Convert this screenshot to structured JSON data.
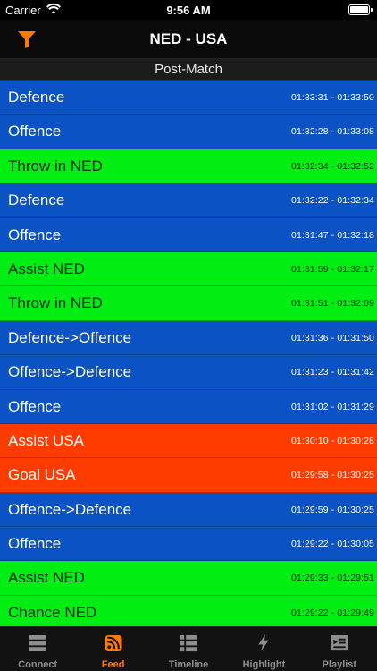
{
  "status": {
    "carrier": "Carrier",
    "time": "9:56 AM"
  },
  "nav": {
    "title": "NED - USA"
  },
  "section": {
    "header": "Post-Match"
  },
  "colors": {
    "accent": "#ff7a00",
    "blue": "#0b52c4",
    "green": "#00ee12",
    "orange": "#ff3c00"
  },
  "feed": [
    {
      "label": "Defence",
      "range": "01:33:31 - 01:33:50",
      "kind": "defence"
    },
    {
      "label": "Offence",
      "range": "01:32:28 - 01:33:08",
      "kind": "offence"
    },
    {
      "label": "Throw in NED",
      "range": "01:32:34 - 01:32:52",
      "kind": "green"
    },
    {
      "label": "Defence",
      "range": "01:32:22 - 01:32:34",
      "kind": "defence"
    },
    {
      "label": "Offence",
      "range": "01:31:47 - 01:32:18",
      "kind": "offence"
    },
    {
      "label": "Assist NED",
      "range": "01:31:59 - 01:32:17",
      "kind": "green"
    },
    {
      "label": "Throw in NED",
      "range": "01:31:51 - 01:32:09",
      "kind": "green"
    },
    {
      "label": "Defence->Offence",
      "range": "01:31:36 - 01:31:50",
      "kind": "transition"
    },
    {
      "label": "Offence->Defence",
      "range": "01:31:23 - 01:31:42",
      "kind": "transition"
    },
    {
      "label": "Offence",
      "range": "01:31:02 - 01:31:29",
      "kind": "offence"
    },
    {
      "label": "Assist USA",
      "range": "01:30:10 - 01:30:28",
      "kind": "orange"
    },
    {
      "label": "Goal USA",
      "range": "01:29:58 - 01:30:25",
      "kind": "orange"
    },
    {
      "label": "Offence->Defence",
      "range": "01:29:59 - 01:30:25",
      "kind": "transition"
    },
    {
      "label": "Offence",
      "range": "01:29:22 - 01:30:05",
      "kind": "offence"
    },
    {
      "label": "Assist NED",
      "range": "01:29:33 - 01:29:51",
      "kind": "green"
    },
    {
      "label": "Chance NED",
      "range": "01:29:22 - 01:29:49",
      "kind": "green"
    }
  ],
  "tabs": [
    {
      "label": "Connect",
      "icon": "server-icon"
    },
    {
      "label": "Feed",
      "icon": "rss-icon",
      "active": true
    },
    {
      "label": "Timeline",
      "icon": "list-icon"
    },
    {
      "label": "Highlight",
      "icon": "bolt-icon"
    },
    {
      "label": "Playlist",
      "icon": "playlist-icon"
    }
  ]
}
